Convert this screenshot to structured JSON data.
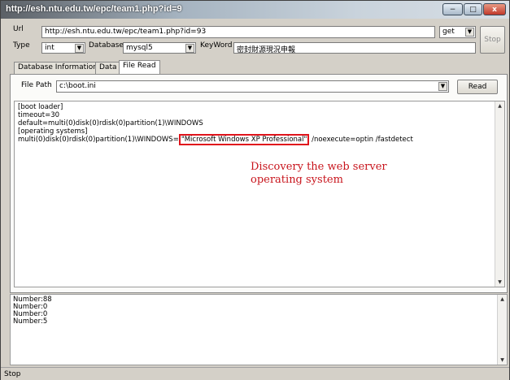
{
  "window": {
    "title": "http://esh.ntu.edu.tw/epc/team1.php?id=9",
    "minimize": "−",
    "maximize": "□",
    "close": "x"
  },
  "toolbar": {
    "url_label": "Url",
    "url_value": "http://esh.ntu.edu.tw/epc/team1.php?id=93",
    "method_value": "get",
    "stop_label": "Stop",
    "type_label": "Type",
    "type_value": "int",
    "database_label": "Database",
    "database_value": "mysql5",
    "keyword_label": "KeyWord",
    "keyword_value": "密封財源現況申報"
  },
  "tabs": [
    {
      "label": "Database Information"
    },
    {
      "label": "Data"
    },
    {
      "label": "File Read"
    }
  ],
  "file_read": {
    "path_label": "File Path",
    "path_value": "c:\\boot.ini",
    "read_button": "Read",
    "content": {
      "line1": "[boot loader]",
      "line2": "timeout=30",
      "line3": "default=multi(0)disk(0)rdisk(0)partition(1)\\WINDOWS",
      "line4": "[operating systems]",
      "line5_prefix": "multi(0)disk(0)rdisk(0)partition(1)\\WINDOWS=",
      "line5_highlight": "\"Microsoft Windows XP Professional\"",
      "line5_suffix": " /noexecute=optin /fastdetect"
    },
    "annotation_line1": "Discovery the web server",
    "annotation_line2": "operating system",
    "annotation_color": "#c8141c"
  },
  "numbers": [
    "Number:88",
    "Number:0",
    "Number:0",
    "Number:5"
  ],
  "status_text": "Stop"
}
